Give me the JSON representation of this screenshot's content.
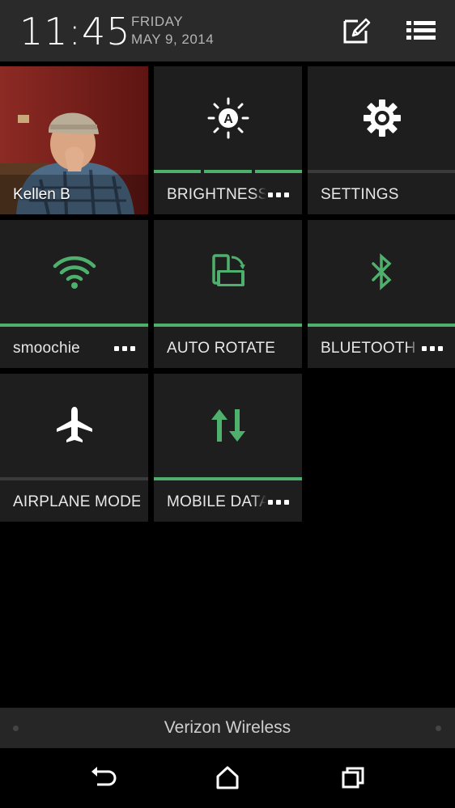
{
  "status": {
    "time": "11:45",
    "day": "FRIDAY",
    "date": "MAY 9, 2014"
  },
  "header_buttons": {
    "edit_icon": "edit-icon",
    "list_icon": "list-icon"
  },
  "tiles": [
    {
      "label": "Kellen B",
      "icon": "contact-photo",
      "state": "photo"
    },
    {
      "label": "BRIGHTNESS",
      "icon": "brightness-auto-icon",
      "state": "on",
      "has_more": true
    },
    {
      "label": "SETTINGS",
      "icon": "gear-icon",
      "state": "off"
    },
    {
      "label": "smoochie",
      "icon": "wifi-icon",
      "state": "on",
      "has_more": true
    },
    {
      "label": "AUTO ROTATE",
      "icon": "auto-rotate-icon",
      "state": "on"
    },
    {
      "label": "BLUETOOTH",
      "icon": "bluetooth-icon",
      "state": "on",
      "has_more": true
    },
    {
      "label": "AIRPLANE MODE",
      "icon": "airplane-icon",
      "state": "off"
    },
    {
      "label": "MOBILE DATA",
      "icon": "mobile-data-icon",
      "state": "on",
      "has_more": true
    }
  ],
  "carrier": "Verizon Wireless",
  "navigation": {
    "back": "back-icon",
    "home": "home-icon",
    "recents": "recents-icon"
  },
  "colors": {
    "accent_green": "#4fb06e",
    "tile_bg": "#1e1e1e",
    "header_bg": "#2a2a2a"
  }
}
